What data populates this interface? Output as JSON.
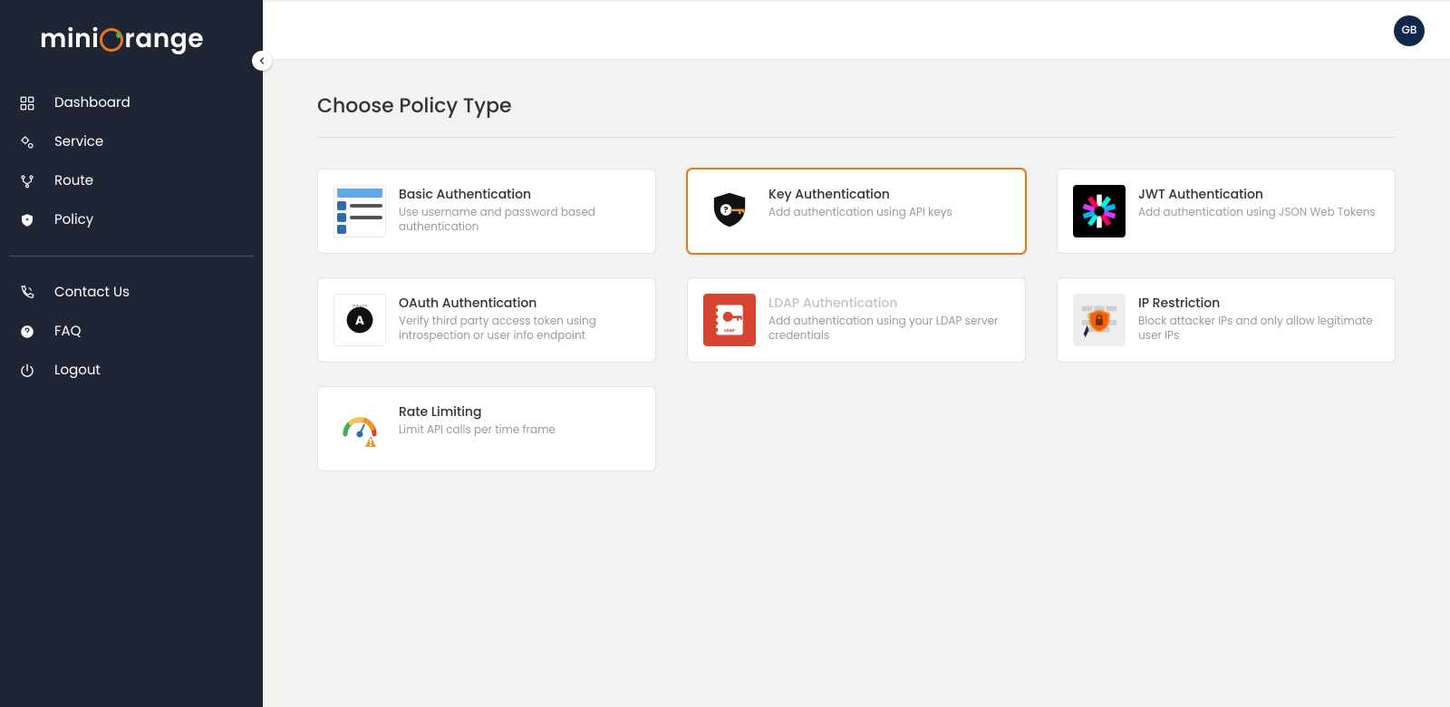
{
  "brand": "miniOrange",
  "user": {
    "initials": "GB"
  },
  "sidebar": {
    "primary": [
      {
        "label": "Dashboard",
        "icon": "dashboard"
      },
      {
        "label": "Service",
        "icon": "service"
      },
      {
        "label": "Route",
        "icon": "route"
      },
      {
        "label": "Policy",
        "icon": "policy"
      }
    ],
    "secondary": [
      {
        "label": "Contact Us",
        "icon": "contact"
      },
      {
        "label": "FAQ",
        "icon": "faq"
      },
      {
        "label": "Logout",
        "icon": "logout"
      }
    ]
  },
  "page": {
    "title": "Choose Policy Type"
  },
  "policies": [
    {
      "id": "basic",
      "title": "Basic Authentication",
      "desc": "Use username and password based authentication",
      "selected": false,
      "muted": false
    },
    {
      "id": "key",
      "title": "Key Authentication",
      "desc": "Add authentication using API keys",
      "selected": true,
      "muted": false
    },
    {
      "id": "jwt",
      "title": "JWT Authentication",
      "desc": "Add authentication using JSON Web Tokens",
      "selected": false,
      "muted": false
    },
    {
      "id": "oauth",
      "title": "OAuth Authentication",
      "desc": "Verify third party access token using introspection or user info endpoint",
      "selected": false,
      "muted": false
    },
    {
      "id": "ldap",
      "title": "LDAP Authentication",
      "desc": "Add authentication using your LDAP server credentials",
      "selected": false,
      "muted": true
    },
    {
      "id": "ip",
      "title": "IP Restriction",
      "desc": "Block attacker IPs and only allow legitimate user IPs",
      "selected": false,
      "muted": false
    },
    {
      "id": "rate",
      "title": "Rate Limiting",
      "desc": "Limit API calls per time frame",
      "selected": false,
      "muted": false
    }
  ]
}
